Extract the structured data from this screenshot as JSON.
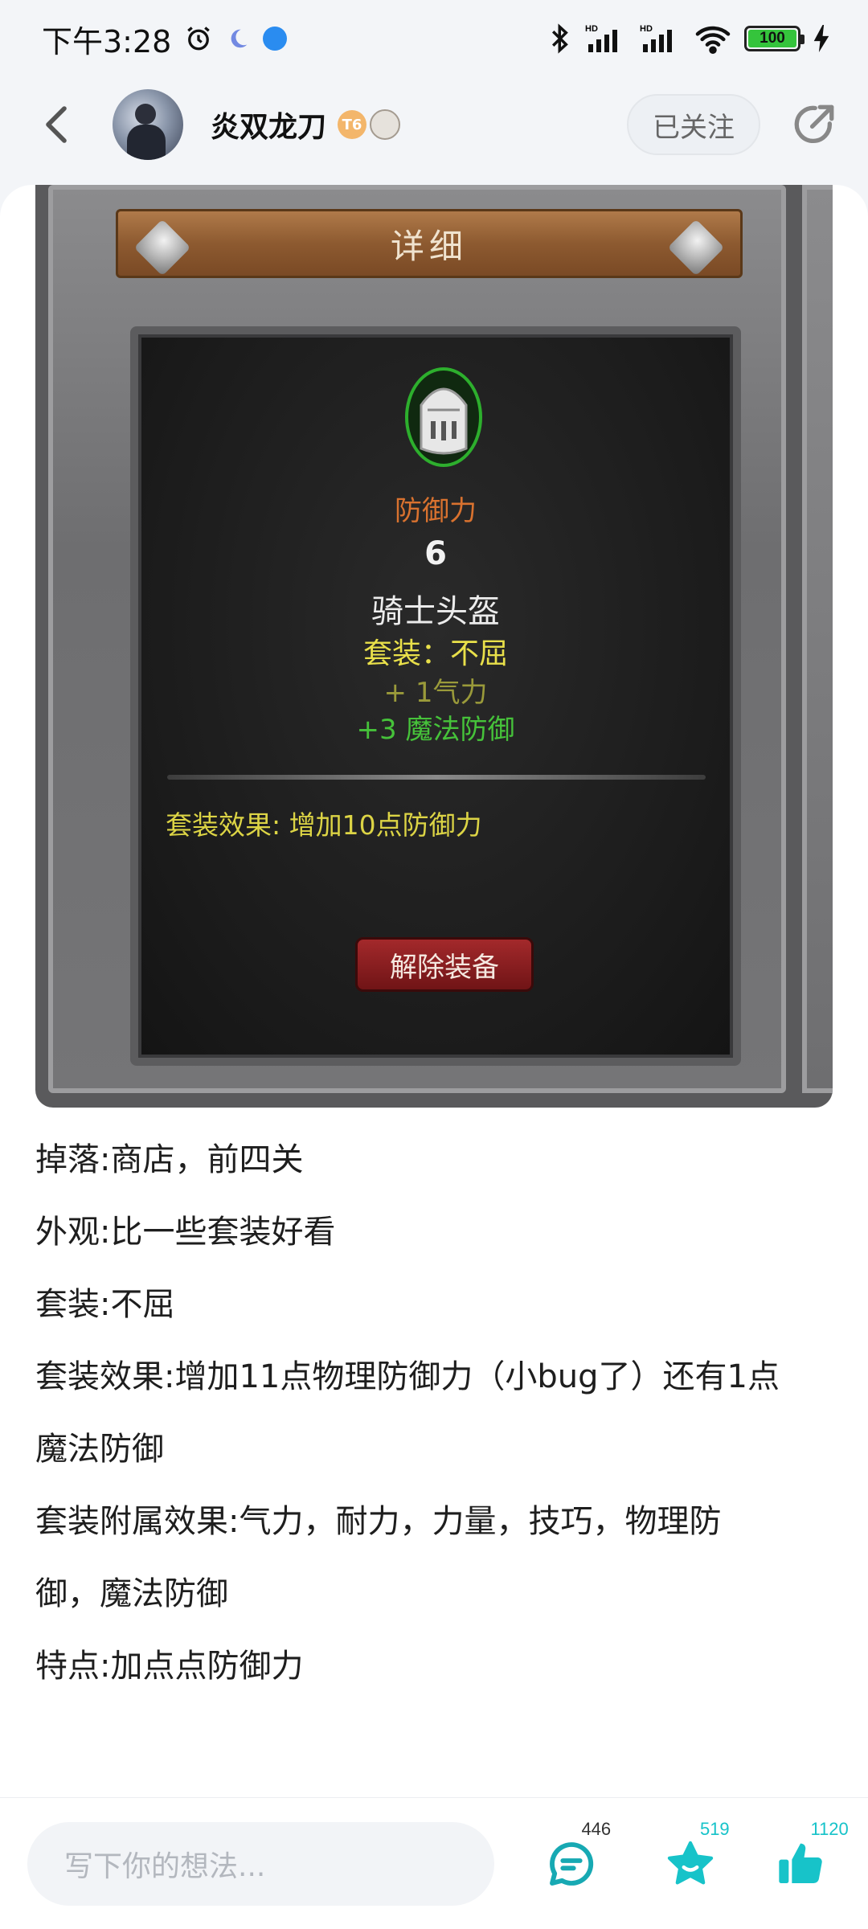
{
  "status_bar": {
    "time": "下午3:28",
    "battery": "100"
  },
  "header": {
    "username": "炎双龙刀",
    "level_badge": "T6",
    "follow_label": "已关注"
  },
  "game_screenshot": {
    "panel_title": "详细",
    "attribute_label": "防御力",
    "attribute_value": "6",
    "item_name": "骑士头盔",
    "set_line": "套装：不屈",
    "bonus_1": "+ 1气力",
    "bonus_2": "+3 魔法防御",
    "set_effect": "套装效果:  增加10点防御力",
    "unequip_label": "解除装备"
  },
  "article": {
    "lines": [
      "掉落:商店，前四关",
      "外观:比一些套装好看",
      "套装:不屈",
      "套装效果:增加11点物理防御力（小bug了）还有1点",
      "魔法防御",
      "套装附属效果:气力，耐力，力量，技巧，物理防",
      "御，魔法防御",
      "特点:加点点防御力"
    ]
  },
  "bottom_bar": {
    "comment_placeholder": "写下你的想法...",
    "comment_count": "446",
    "favorite_count": "519",
    "like_count": "1120"
  },
  "colors": {
    "accent": "#17c3c9",
    "attribute_orange": "#d9722f",
    "set_yellow": "#e9e04a",
    "bonus_green": "#46c23a",
    "unequip_red": "#8b1d1f"
  },
  "icons": {
    "back": "chevron-left-icon",
    "share": "share-icon",
    "comment": "comment-icon",
    "favorite": "star-icon",
    "like": "thumbs-up-icon",
    "helmet": "helmet-icon"
  }
}
